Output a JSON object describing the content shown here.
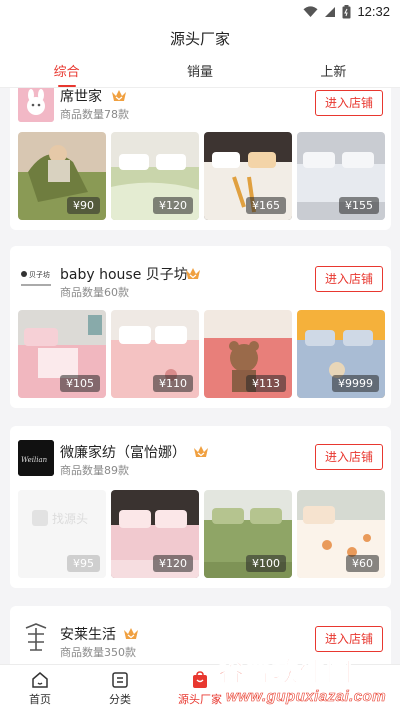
{
  "status_bar": {
    "time": "12:32",
    "icons": [
      "wifi-icon",
      "signal-icon",
      "battery-icon"
    ]
  },
  "header": {
    "title": "源头厂家"
  },
  "tabs": [
    {
      "label": "综合",
      "active": true
    },
    {
      "label": "销量",
      "active": false
    },
    {
      "label": "上新",
      "active": false
    }
  ],
  "shops": [
    {
      "name": "席世家",
      "count": "商品数量78款",
      "enter_label": "进入店铺",
      "prices": [
        "¥90",
        "¥120",
        "¥165",
        "¥155"
      ]
    },
    {
      "name": "baby house 贝子坊",
      "count": "商品数量60款",
      "enter_label": "进入店铺",
      "logo_text": "贝子坊",
      "prices": [
        "¥105",
        "¥110",
        "¥113",
        "¥9999"
      ]
    },
    {
      "name": "微廉家纺（富怡娜）",
      "count": "商品数量89款",
      "enter_label": "进入店铺",
      "logo_text": "Weilian",
      "placeholder_text": "找源头",
      "prices": [
        "¥95",
        "¥120",
        "¥100",
        "¥60"
      ]
    },
    {
      "name": "安莱生活",
      "count": "商品数量350款",
      "enter_label": "进入店铺"
    }
  ],
  "bottom_nav": [
    {
      "label": "首页",
      "icon": "home-icon",
      "active": false
    },
    {
      "label": "分类",
      "icon": "category-icon",
      "active": false
    },
    {
      "label": "源头厂家",
      "icon": "factory-bag-icon",
      "active": true
    }
  ],
  "watermark": {
    "main": "谷普软件园",
    "sub": "www.gupuxiazai.com"
  },
  "colors": {
    "accent": "#e8372f",
    "crown": "#f0a040",
    "background": "#f4f4f6"
  }
}
